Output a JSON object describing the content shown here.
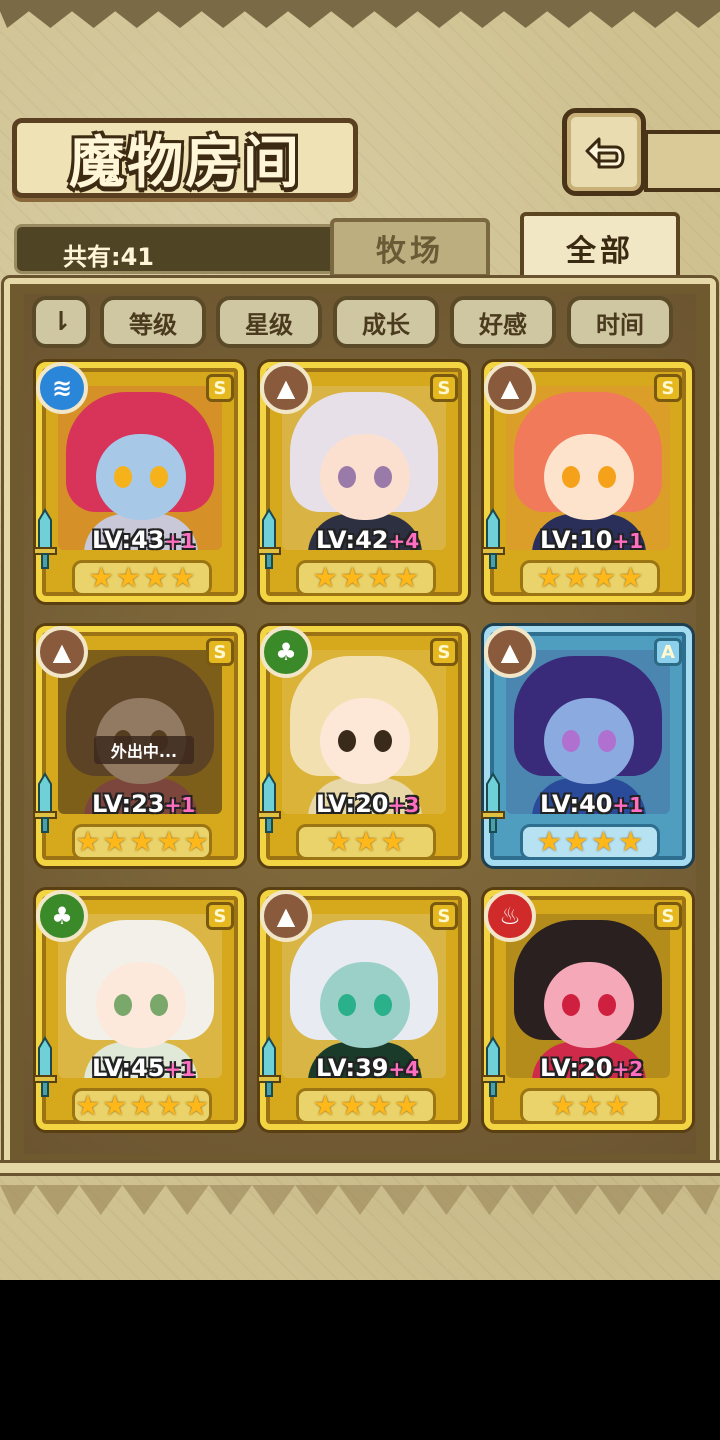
{
  "title": "魔物房间",
  "count_text": "共有:41",
  "tabs": {
    "ranch": "牧场",
    "all": "全部"
  },
  "sort": {
    "toggle_label": "⇂",
    "level": "等级",
    "star": "星级",
    "growth": "成长",
    "favor": "好感",
    "time": "时间"
  },
  "away_label": "外出中...",
  "cards": [
    {
      "element": "water",
      "rank": "S",
      "level": "LV:43",
      "plus": "+1",
      "stars": 4,
      "hair": "#d8345a",
      "skin": "#a8c8e8",
      "eye": "#f5b21a",
      "outfit": "#c8c8d8",
      "element_color": "#2a86d8",
      "element_icon": "≋"
    },
    {
      "element": "earth",
      "rank": "S",
      "level": "LV:42",
      "plus": "+4",
      "stars": 4,
      "hair": "#e8e0e8",
      "skin": "#fbe0d0",
      "eye": "#9a7aa8",
      "outfit": "#2c3040",
      "element_color": "#8a5a3c",
      "element_icon": "▲"
    },
    {
      "element": "earth",
      "rank": "S",
      "level": "LV:10",
      "plus": "+1",
      "stars": 4,
      "hair": "#f07a5a",
      "skin": "#fde2cc",
      "eye": "#f5a21a",
      "outfit": "#2a2f5a",
      "element_color": "#8a5a3c",
      "element_icon": "▲"
    },
    {
      "element": "earth",
      "rank": "S",
      "level": "LV:23",
      "plus": "+1",
      "stars": 5,
      "hair": "#7a5a3a",
      "skin": "#f0d0c0",
      "eye": "#6a4a2a",
      "outfit": "#c06070",
      "element_color": "#8a5a3c",
      "element_icon": "▲",
      "away": true
    },
    {
      "element": "wood",
      "rank": "S",
      "level": "LV:20",
      "plus": "+3",
      "stars": 3,
      "hair": "#f3e0b0",
      "skin": "#fde8d8",
      "eye": "#3a2a1a",
      "outfit": "#e8d8a8",
      "element_color": "#3a8a2a",
      "element_icon": "♣"
    },
    {
      "element": "earth",
      "rank": "A",
      "level": "LV:40",
      "plus": "+1",
      "stars": 4,
      "hair": "#3a2a7a",
      "skin": "#8aaae0",
      "eye": "#b070d0",
      "outfit": "#2a4a9a",
      "element_color": "#8a5a3c",
      "element_icon": "▲"
    },
    {
      "element": "wood",
      "rank": "S",
      "level": "LV:45",
      "plus": "+1",
      "stars": 5,
      "hair": "#f2f0e8",
      "skin": "#fde8dc",
      "eye": "#7aa86a",
      "outfit": "#e0e8d8",
      "element_color": "#3a8a2a",
      "element_icon": "♣"
    },
    {
      "element": "earth",
      "rank": "S",
      "level": "LV:39",
      "plus": "+4",
      "stars": 4,
      "hair": "#e8ecf2",
      "skin": "#9ad0c8",
      "eye": "#2ab08a",
      "outfit": "#1a3a2a",
      "element_color": "#8a5a3c",
      "element_icon": "▲"
    },
    {
      "element": "fire",
      "rank": "S",
      "level": "LV:20",
      "plus": "+2",
      "stars": 3,
      "hair": "#2a2020",
      "skin": "#f4a8b8",
      "eye": "#d02040",
      "outfit": "#d02a4a",
      "element_color": "#d02a2a",
      "element_icon": "♨"
    }
  ]
}
